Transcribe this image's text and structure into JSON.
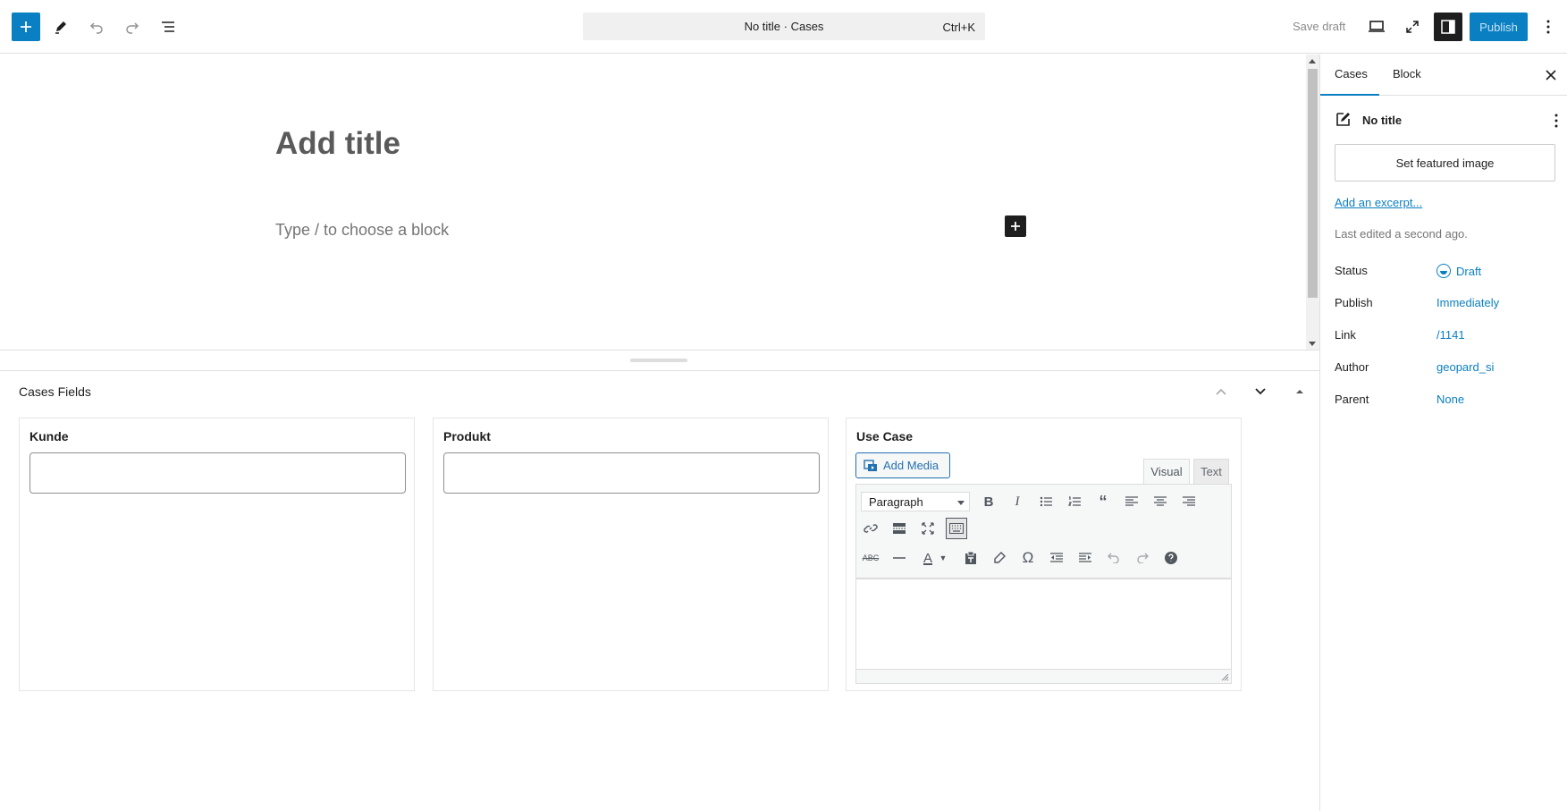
{
  "toolbar": {
    "command_title": "No title · Cases",
    "command_shortcut": "Ctrl+K",
    "save_draft": "Save draft",
    "publish": "Publish"
  },
  "editor": {
    "title_placeholder": "Add title",
    "block_placeholder": "Type / to choose a block"
  },
  "metabox": {
    "title": "Cases Fields",
    "fields": [
      {
        "label": "Kunde"
      },
      {
        "label": "Produkt"
      },
      {
        "label": "Use Case"
      }
    ],
    "add_media": "Add Media",
    "tab_visual": "Visual",
    "tab_text": "Text",
    "format_select": "Paragraph"
  },
  "sidebar": {
    "tabs": [
      "Cases",
      "Block"
    ],
    "post_title": "No title",
    "featured_image": "Set featured image",
    "excerpt_link": "Add an excerpt...",
    "last_edited": "Last edited a second ago.",
    "rows": [
      {
        "label": "Status",
        "value": "Draft"
      },
      {
        "label": "Publish",
        "value": "Immediately"
      },
      {
        "label": "Link",
        "value": "/1141"
      },
      {
        "label": "Author",
        "value": "geopard_si"
      },
      {
        "label": "Parent",
        "value": "None"
      }
    ]
  },
  "colors": {
    "accent": "#0a7fc1",
    "publish_text": "#c7e2f4",
    "dark": "#1e1e1e"
  }
}
